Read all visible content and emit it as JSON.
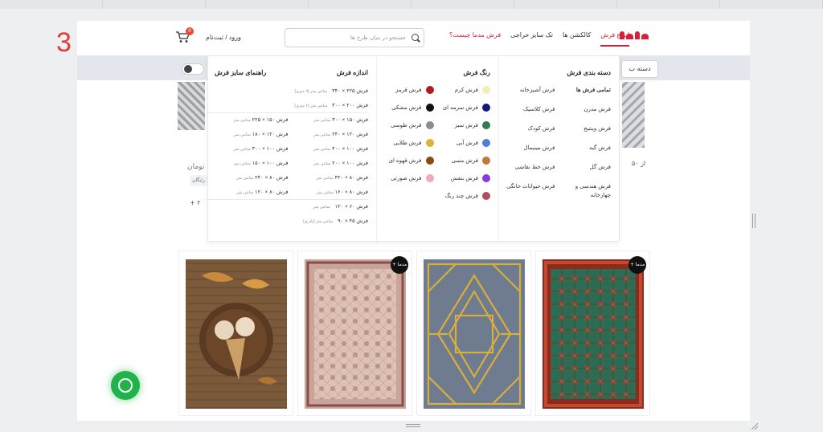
{
  "step_number": "3",
  "header": {
    "nav": [
      "انواع فرش",
      "کالکشن ها",
      "تک سایز حراجی",
      "فرش مدما چیست؟"
    ],
    "search_placeholder": "جستجو در میان طرح ها",
    "login": "ورود / ثبت‌نام",
    "cart_count": "0"
  },
  "category_button": "دسته ب",
  "mega_menu": {
    "categories": {
      "title": "دسته بندی فرش",
      "items": [
        "تمامی فرش ها",
        "فرش آشپزخانه",
        "فرش مدرن",
        "فرش کلاسیک",
        "فرش وینتیج",
        "فرش کودک",
        "فرش گبه",
        "فرش مینیمال",
        "فرش گل",
        "فرش خط نقاشی",
        "فرش هندسی و چهارخانه",
        "فرش حیوانات خانگی"
      ]
    },
    "colors": {
      "title": "رنگ فرش",
      "items": [
        {
          "label": "فرش کرم",
          "color": "#f4eeb0"
        },
        {
          "label": "فرش قرمز",
          "color": "#b31b1b"
        },
        {
          "label": "فرش سرمه ای",
          "color": "#12197a"
        },
        {
          "label": "فرش مشکی",
          "color": "#111111"
        },
        {
          "label": "فرش سبز",
          "color": "#2f7d4f"
        },
        {
          "label": "فرش طوسی",
          "color": "#8c8c8c"
        },
        {
          "label": "فرش آبی",
          "color": "#4a7fdc"
        },
        {
          "label": "فرش طلایی",
          "color": "#d6b637"
        },
        {
          "label": "فرش مسی",
          "color": "#c0793b"
        },
        {
          "label": "فرش قهوه ای",
          "color": "#8a4a12"
        },
        {
          "label": "فرش بنفش",
          "color": "#8a38e0"
        },
        {
          "label": "فرش صورتی",
          "color": "#f1a9b6"
        },
        {
          "label": "فرش چند رنگ",
          "color": "#b44a5a"
        }
      ]
    },
    "sizes": {
      "title": "اندازه فرش",
      "guide": "راهنمای سایز فرش",
      "top_rows": [
        {
          "text": "فرش ۲۲۵ × ۳۴۰",
          "unit": "سانتی متر (۹ متری)"
        },
        {
          "text": "فرش ۲۰۰ × ۳۰۰",
          "unit": "سانتی متر (۶ متری)"
        }
      ],
      "rows": [
        [
          "فرش ۱۵۰ × ۳۰۰",
          "فرش ۱۵۰ × ۲۲۵"
        ],
        [
          "فرش ۱۲۰ × ۲۴۰",
          "فرش ۱۲۰ × ۱۸۰"
        ],
        [
          "فرش ۱۰۰ × ۴۰۰",
          "فرش ۱۰۰ × ۳۰۰"
        ],
        [
          "فرش ۱۰۰ × ۲۰۰",
          "فرش ۱۰۰ × ۱۵۰"
        ],
        [
          "فرش ۸۰ × ۳۲۰",
          "فرش ۸۰ × ۲۴۰"
        ],
        [
          "فرش ۸۰ × ۱۶۰",
          "فرش ۸۰ × ۱۲۰"
        ]
      ],
      "unit": "سانتی متر",
      "bottom_rows": [
        {
          "text": "فرش ۶۰ × ۱۲۰",
          "unit": "سانتی متر"
        },
        {
          "text": "فرش ۴۵ × ۹۰",
          "unit": "سانتی متر (پادری)"
        }
      ]
    }
  },
  "background": {
    "price_unit": "تومان",
    "free_tag": "رایگان",
    "more": "+ ۲",
    "from_label": "از ۵۰"
  },
  "products": [
    {
      "badge": "مدما +"
    },
    {
      "badge": ""
    },
    {
      "badge": "مدما +"
    },
    {
      "badge": ""
    }
  ],
  "colors": {
    "brand": "#d81f3a",
    "whatsapp": "#1fb34a"
  }
}
